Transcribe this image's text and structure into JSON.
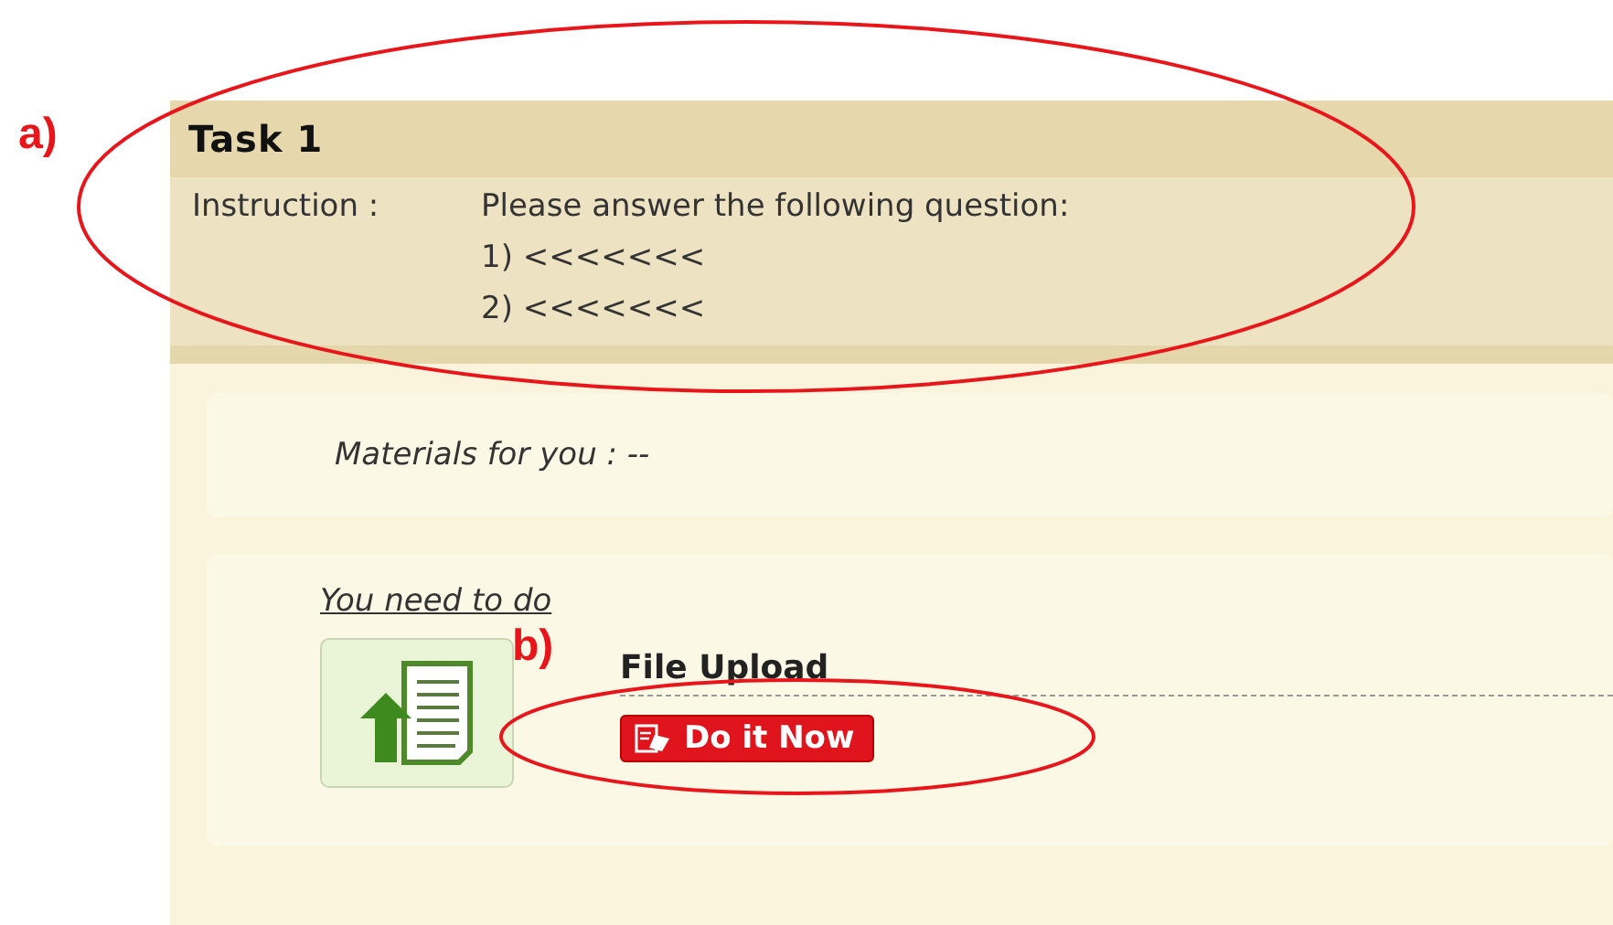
{
  "task": {
    "title": "Task 1",
    "instruction_label": "Instruction :",
    "instruction_text": "Please answer the following question:",
    "questions": [
      "1) <<<<<<<",
      "2) <<<<<<<"
    ]
  },
  "materials": {
    "label": "Materials for you : --"
  },
  "todo": {
    "heading": "You need to do",
    "item_title": "File Upload",
    "button": "Do it Now"
  },
  "annotations": [
    {
      "label": "a)"
    },
    {
      "label": "b)"
    }
  ]
}
